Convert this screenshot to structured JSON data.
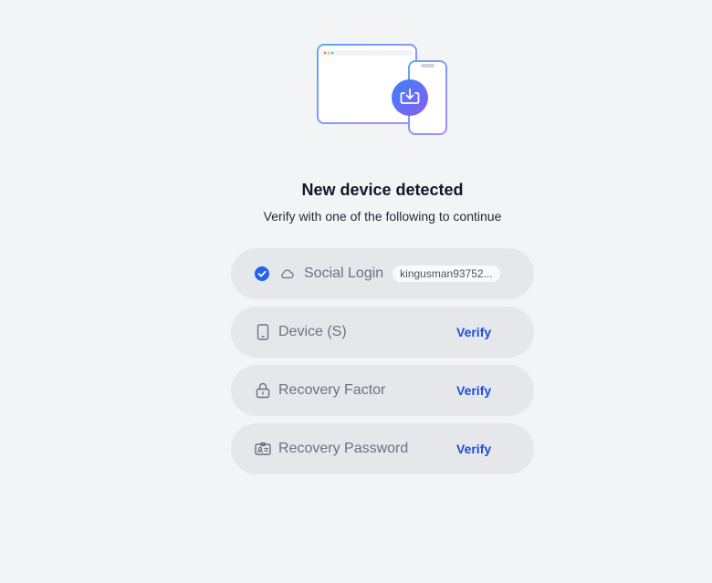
{
  "header": {
    "title": "New device detected",
    "subtitle": "Verify with one of the following to continue"
  },
  "options": [
    {
      "label": "Social Login",
      "icon": "cloud-icon",
      "status": "verified",
      "account": "kingusman93752..."
    },
    {
      "label": "Device (S)",
      "icon": "smartphone-icon",
      "action": "Verify"
    },
    {
      "label": "Recovery Factor",
      "icon": "lock-icon",
      "action": "Verify"
    },
    {
      "label": "Recovery Password",
      "icon": "id-card-icon",
      "action": "Verify"
    }
  ],
  "colors": {
    "background": "#f3f4f6",
    "option_background": "#e5e7eb",
    "accent": "#1d4ed8",
    "check": "#2563eb"
  }
}
